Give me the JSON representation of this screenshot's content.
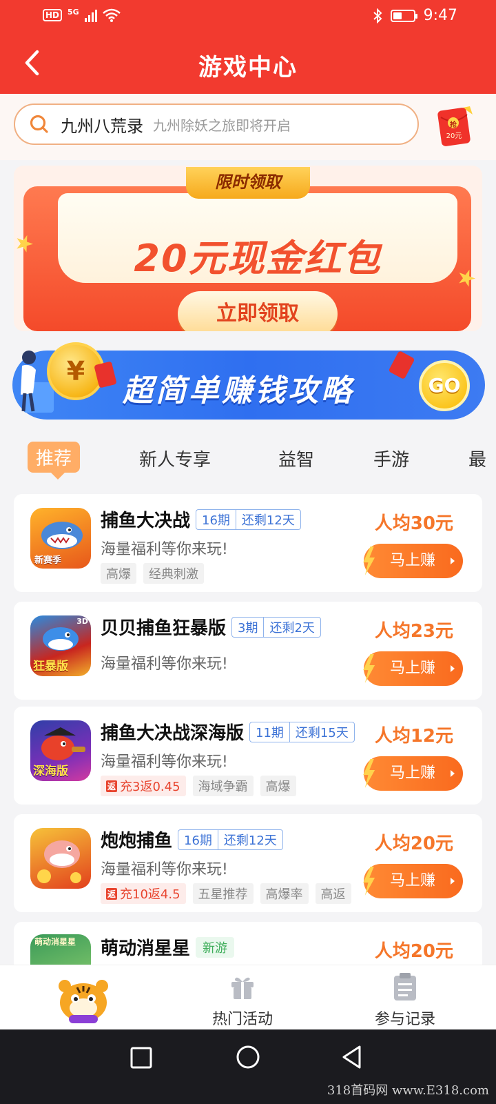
{
  "status_bar": {
    "hd": "HD",
    "network": "5G",
    "time": "9:47"
  },
  "header": {
    "title": "游戏中心"
  },
  "search": {
    "keyword": "九州八荒录",
    "placeholder": "九州除妖之旅即将开启",
    "red_packet_label": "20元",
    "red_packet_char": "抢"
  },
  "promo_banner": {
    "tag": "限时领取",
    "amount": "20元现金红包",
    "button": "立即领取"
  },
  "earn_banner": {
    "coin": "¥",
    "title": "超简单赚钱攻略",
    "go": "GO"
  },
  "tabs": [
    {
      "label": "推荐",
      "active": true
    },
    {
      "label": "新人专享",
      "active": false
    },
    {
      "label": "益智",
      "active": false
    },
    {
      "label": "手游",
      "active": false
    },
    {
      "label": "最",
      "active": false
    }
  ],
  "games": [
    {
      "name": "捕鱼大决战",
      "period": "16期",
      "remaining": "还剩12天",
      "desc": "海量福利等你来玩!",
      "tags": [
        "高爆",
        "经典刺激"
      ],
      "reward": "人均30元",
      "button": "马上赚",
      "icon_text": "新赛季"
    },
    {
      "name": "贝贝捕鱼狂暴版",
      "period": "3期",
      "remaining": "还剩2天",
      "desc": "海量福利等你来玩!",
      "tags": [],
      "reward": "人均23元",
      "button": "马上赚",
      "icon_text": "狂暴版",
      "icon_badge": "3D"
    },
    {
      "name": "捕鱼大决战深海版",
      "period": "11期",
      "remaining": "还剩15天",
      "desc": "海量福利等你来玩!",
      "rebate": {
        "badge": "返",
        "text": "充3返0.45"
      },
      "tags": [
        "海域争霸",
        "高爆"
      ],
      "reward": "人均12元",
      "button": "马上赚",
      "icon_text": "深海版"
    },
    {
      "name": "炮炮捕鱼",
      "period": "16期",
      "remaining": "还剩12天",
      "desc": "海量福利等你来玩!",
      "rebate": {
        "badge": "返",
        "text": "充10返4.5"
      },
      "tags": [
        "五星推荐",
        "高爆率",
        "高返"
      ],
      "reward": "人均20元",
      "button": "马上赚"
    },
    {
      "name": "萌动消星星",
      "new_tag": "新游",
      "reward": "人均20元",
      "icon_text": "萌动消星星"
    }
  ],
  "bottom_nav": [
    {
      "label": "",
      "icon": "tiger-mascot-icon"
    },
    {
      "label": "热门活动",
      "icon": "gift-icon"
    },
    {
      "label": "参与记录",
      "icon": "clipboard-icon"
    }
  ],
  "watermark": "318首码网  www.E318.com",
  "colors": {
    "header_red": "#f23a2f",
    "accent_orange": "#f5762a",
    "period_blue": "#3d73d6",
    "banner_blue": "#2f6ff0"
  }
}
